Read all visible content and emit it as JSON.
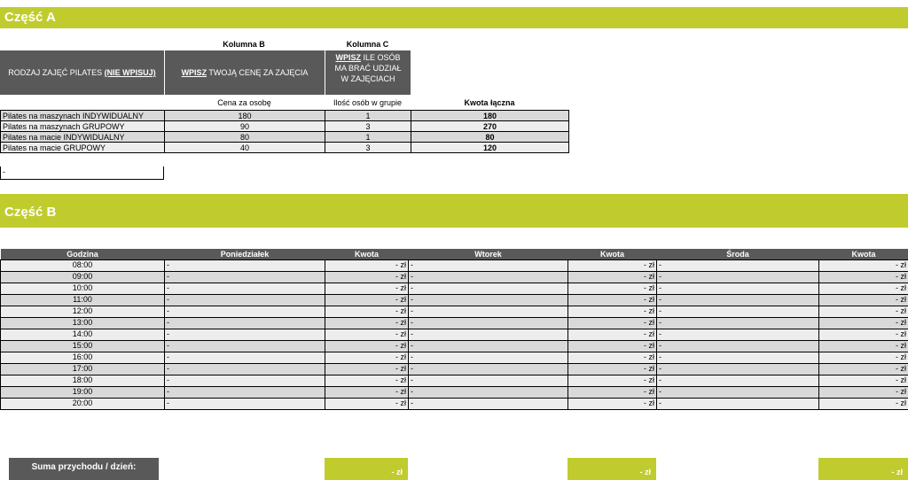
{
  "partA": {
    "title": "Część A",
    "col_b_title": "Kolumna B",
    "col_c_title": "Kolumna C",
    "header_type_text": "RODZAJ ZAJĘĆ PILATES",
    "header_type_note": "(NIE WPISUJ)",
    "header_price_u": "WPISZ",
    "header_price_text": "TWOJĄ CENĘ ZA ZAJĘCIA",
    "header_people_u": "WPISZ",
    "header_people_line1": "ILE OSÓB",
    "header_people_line2": "MA BRAĆ UDZIAŁ",
    "header_people_line3": "W ZAJĘCIACH",
    "sub_price": "Cena za osobę",
    "sub_people": "Ilość osób w grupie",
    "sub_total": "Kwota łączna",
    "rows": [
      {
        "name": "Pilates na maszynach INDYWIDUALNY",
        "price": "180",
        "people": "1",
        "total": "180"
      },
      {
        "name": "Pilates na maszynach GRUPOWY",
        "price": "90",
        "people": "3",
        "total": "270"
      },
      {
        "name": "Pilates na macie INDYWIDUALNY",
        "price": "80",
        "people": "1",
        "total": "80"
      },
      {
        "name": "Pilates na macie GRUPOWY",
        "price": "40",
        "people": "3",
        "total": "120"
      }
    ],
    "blank_row": "-"
  },
  "partB": {
    "title": "Część B",
    "headers": {
      "hour": "Godzina",
      "monday": "Poniedziałek",
      "amount": "Kwota",
      "tuesday": "Wtorek",
      "wednesday": "Środa"
    },
    "hours": [
      "08:00",
      "09:00",
      "10:00",
      "11:00",
      "12:00",
      "13:00",
      "14:00",
      "15:00",
      "16:00",
      "17:00",
      "18:00",
      "19:00",
      "20:00"
    ],
    "cell_dash": "-",
    "amount_text": "-  zł",
    "sum_label": "Suma przychodu / dzień:",
    "sum_value": "-  zł"
  },
  "colors": {
    "accent": "#c0cc2d",
    "header_dark": "#595959",
    "row_gray": "#d9d9d9"
  }
}
